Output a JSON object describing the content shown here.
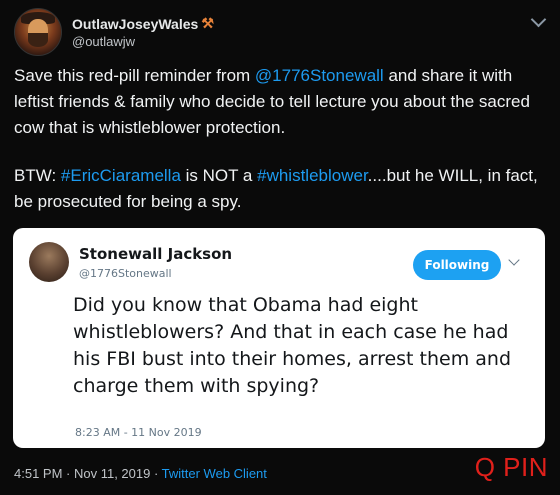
{
  "tweet": {
    "display_name": "OutlawJoseyWales",
    "name_emoji": "⚒",
    "handle": "@outlawjw",
    "text_line1_pre": "Save this red-pill reminder from ",
    "mention": "@1776Stonewall",
    "text_line1_post": " and share it with leftist friends & family who decide to tell lecture you about the sacred cow that is whistleblower protection.",
    "text_line2_pre": "BTW: ",
    "hashtag1": "#EricCiaramella",
    "text_line2_mid": " is NOT a ",
    "hashtag2": "#whistleblower",
    "text_line2_post": "....but he WILL, in fact, be prosecuted for being a spy.",
    "timestamp": "4:51 PM · Nov 11, 2019 · ",
    "client": "Twitter Web Client"
  },
  "embedded": {
    "name": "Stonewall Jackson",
    "handle": "@1776Stonewall",
    "follow_label": "Following",
    "text": "Did you know that Obama had eight whistleblowers? And that in each case he had his FBI bust into their homes, arrest them and charge them with spying?",
    "time": "8:23 AM - 11 Nov 2019"
  },
  "watermark": "Q PIN",
  "colors": {
    "link": "#1d9bf0",
    "follow": "#1da1f2",
    "watermark": "#e0201b"
  }
}
